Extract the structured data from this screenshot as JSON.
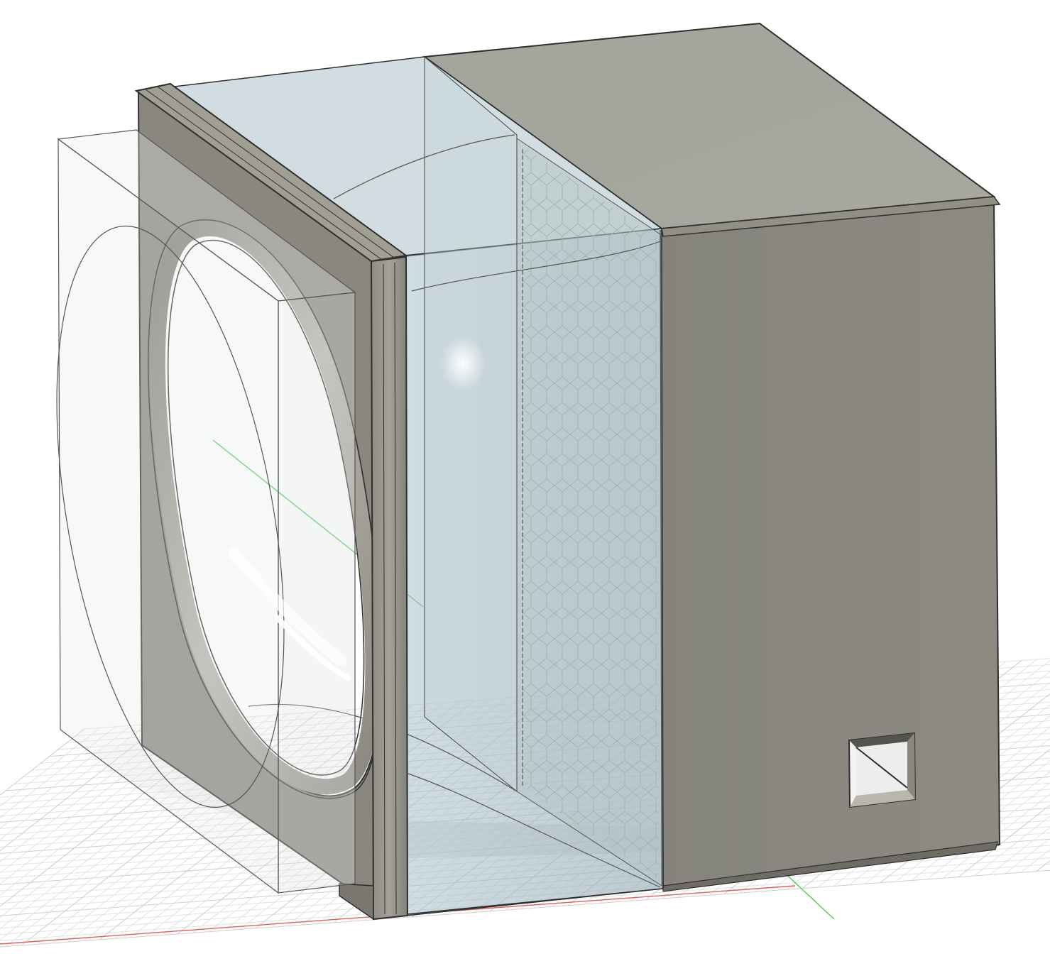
{
  "viewport": {
    "background": "#ffffff"
  },
  "colors": {
    "grid_minor": "#e2e2e2",
    "grid_major": "#cdcdcd",
    "axis_x": "#e06060",
    "axis_y": "#55c855",
    "body_side": "#888880",
    "body_top": "#a5a79e",
    "body_edge": "#2e2e2e",
    "frame": "#9a978d",
    "frame_dark": "#7a776e",
    "glass": "#a9c2cc",
    "ghost_box": "#cfd3d3",
    "mesh": "#a9b4b4"
  },
  "icons": {
    "port": "square-port-icon"
  }
}
